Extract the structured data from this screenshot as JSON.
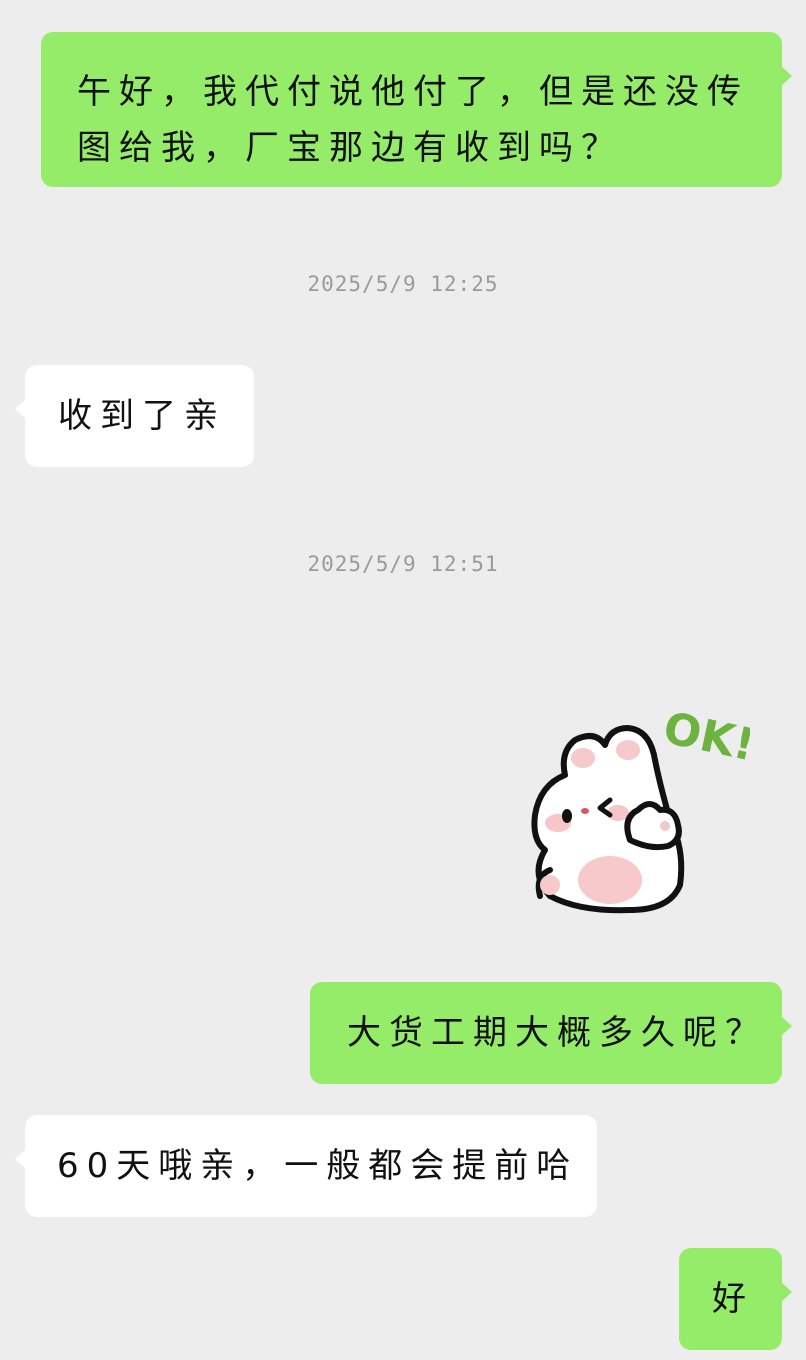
{
  "chat": {
    "messages": [
      {
        "side": "right",
        "text": "午好，我代付说他付了，但是还没传图给我，厂宝那边有收到吗？"
      },
      {
        "type": "timestamp",
        "text": "2025/5/9 12:25"
      },
      {
        "side": "left",
        "text": "收到了亲"
      },
      {
        "type": "timestamp",
        "text": "2025/5/9 12:51"
      },
      {
        "side": "right",
        "type": "sticker",
        "icon": "bunny-ok-sticker-icon",
        "sticker_text": "OK!"
      },
      {
        "side": "right",
        "text": "大货工期大概多久呢？"
      },
      {
        "side": "left",
        "text": "60天哦亲，一般都会提前哈"
      },
      {
        "side": "right",
        "text": "好"
      }
    ]
  },
  "colors": {
    "background": "#ededed",
    "outgoing_bubble": "#95ec69",
    "incoming_bubble": "#ffffff",
    "timestamp_text": "#9a9a9a",
    "sticker_accent": "#6db33f"
  }
}
